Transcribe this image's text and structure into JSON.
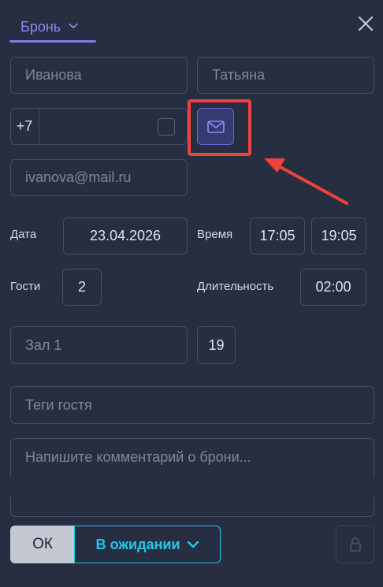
{
  "header": {
    "tab_label": "Бронь",
    "chevron_icon": "chevron-down-icon",
    "close_icon": "close-icon"
  },
  "guest": {
    "last_name": {
      "value": "",
      "placeholder": "Иванова"
    },
    "first_name": {
      "value": "",
      "placeholder": "Татьяна"
    },
    "phone_prefix": "+7",
    "phone": {
      "value": ""
    },
    "email": {
      "value": "",
      "placeholder": "ivanova@mail.ru"
    },
    "email_button_icon": "envelope-icon"
  },
  "booking": {
    "date_label": "Дата",
    "date_value": "23.04.2026",
    "time_label": "Время",
    "time_from": "17:05",
    "time_to": "19:05",
    "guests_label": "Гости",
    "guests_value": "2",
    "duration_label": "Длительность",
    "duration_value": "02:00",
    "hall": {
      "value": "",
      "placeholder": "Зал 1"
    },
    "table_number": "19",
    "tags": {
      "placeholder": "Теги гостя"
    },
    "comment": {
      "placeholder": "Напишите комментарий о брони..."
    }
  },
  "footer": {
    "ok_label": "ОК",
    "status_label": "В ожидании",
    "lock_icon": "lock-icon"
  },
  "colors": {
    "background": "#272e41",
    "accent": "#7d7cf0",
    "status": "#22c9ea",
    "highlight": "#f0413a"
  }
}
